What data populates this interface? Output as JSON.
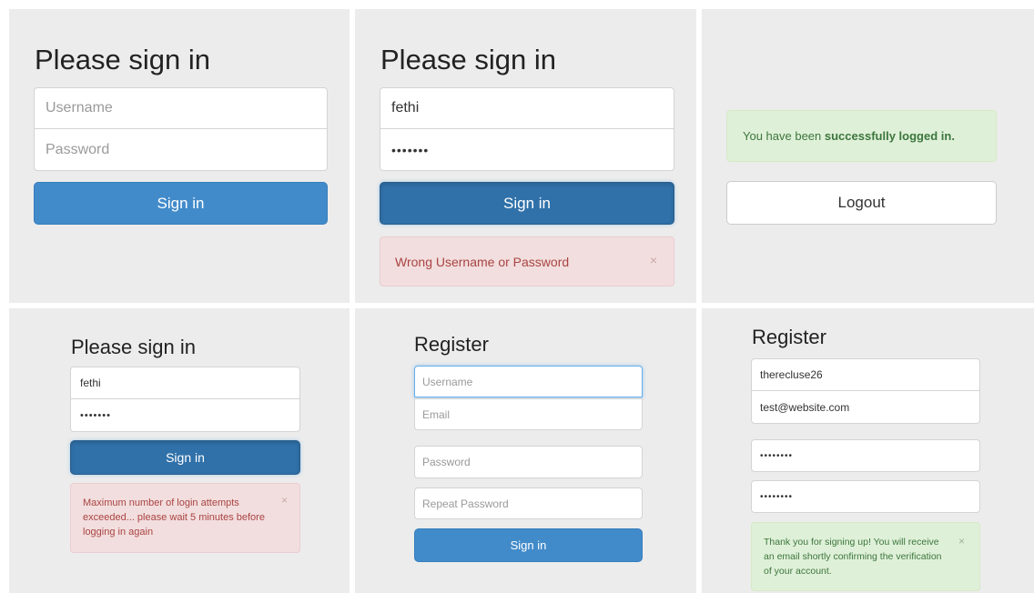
{
  "panel1": {
    "title": "Please sign in",
    "username_placeholder": "Username",
    "password_placeholder": "Password",
    "signin_label": "Sign in"
  },
  "panel2": {
    "title": "Please sign in",
    "username_value": "fethi",
    "password_value": "•••••••",
    "signin_label": "Sign in",
    "error_text": "Wrong Username or Password",
    "close_glyph": "×"
  },
  "panel3": {
    "success_prefix": "You have been ",
    "success_bold": "successfully logged in.",
    "logout_label": "Logout"
  },
  "panel4": {
    "title": "Please sign in",
    "username_value": "fethi",
    "password_value": "•••••••",
    "signin_label": "Sign in",
    "error_text": "Maximum number of login attempts exceeded... please wait 5 minutes before logging in again",
    "close_glyph": "×"
  },
  "panel5": {
    "title": "Register",
    "username_placeholder": "Username",
    "email_placeholder": "Email",
    "password_placeholder": "Password",
    "repeat_password_placeholder": "Repeat Password",
    "signin_label": "Sign in"
  },
  "panel6": {
    "title": "Register",
    "username_value": "therecluse26",
    "email_value": "test@website.com",
    "password_value": "••••••••",
    "repeat_password_value": "••••••••",
    "success_text": "Thank you for signing up! You will receive an email shortly confirming the verification of your account.",
    "close_glyph": "×"
  }
}
